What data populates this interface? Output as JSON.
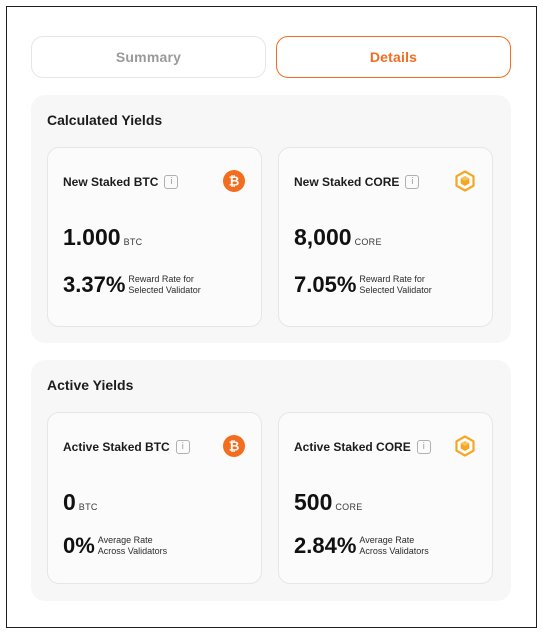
{
  "tabs": [
    {
      "label": "Summary",
      "active": false
    },
    {
      "label": "Details",
      "active": true
    }
  ],
  "accent_color": "#f26d1f",
  "calculated": {
    "title": "Calculated Yields",
    "btc": {
      "label": "New Staked BTC",
      "icon": "bitcoin-icon",
      "amount": "1.000",
      "unit": "BTC",
      "rate": "3.37%",
      "rate_line1": "Reward Rate for",
      "rate_line2": "Selected Validator"
    },
    "core": {
      "label": "New Staked CORE",
      "icon": "core-icon",
      "amount": "8,000",
      "unit": "CORE",
      "rate": "7.05%",
      "rate_line1": "Reward Rate for",
      "rate_line2": "Selected Validator"
    }
  },
  "active": {
    "title": "Active Yields",
    "btc": {
      "label": "Active Staked BTC",
      "icon": "bitcoin-icon",
      "amount": "0",
      "unit": "BTC",
      "rate": "0%",
      "rate_line1": "Average Rate",
      "rate_line2": "Across Validators"
    },
    "core": {
      "label": "Active Staked CORE",
      "icon": "core-icon",
      "amount": "500",
      "unit": "CORE",
      "rate": "2.84%",
      "rate_line1": "Average Rate",
      "rate_line2": "Across Validators"
    }
  },
  "info_glyph": "i"
}
